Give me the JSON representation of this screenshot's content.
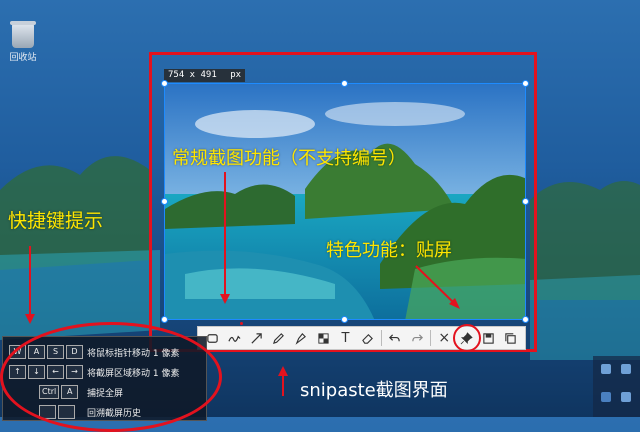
{
  "desktop": {
    "recycle_bin_label": "回收站"
  },
  "capture": {
    "size_readout": "754 x 491",
    "size_unit": "px"
  },
  "toolbar": {
    "tools": [
      "rectangle",
      "pencil-line",
      "arrow",
      "pen",
      "marker",
      "mosaic",
      "text",
      "eraser"
    ],
    "undo": "undo",
    "redo": "redo",
    "close": "×",
    "pin": "pin",
    "save": "save",
    "copy": "copy"
  },
  "annotations": {
    "regular_feature": "常规截图功能（不支持编号）",
    "special_feature": "特色功能：贴屏",
    "shortcut_hints": "快捷键提示",
    "snipaste_ui": "snipaste截图界面"
  },
  "hints": [
    {
      "keys": [
        "W",
        "A",
        "S",
        "D"
      ],
      "desc": "将鼠标指针移动 1 像素"
    },
    {
      "keys": [
        "↑",
        "↓",
        "←",
        "→"
      ],
      "desc": "将截屏区域移动 1 像素"
    },
    {
      "keys": [
        "Ctrl",
        "A"
      ],
      "desc": "捕捉全屏"
    },
    {
      "keys": [
        "",
        ""
      ],
      "desc": "回溯截屏历史"
    }
  ],
  "colors": {
    "accent_red": "#e3121e",
    "annotation_yellow": "#ffe600",
    "selection_blue": "#1e8bff"
  }
}
